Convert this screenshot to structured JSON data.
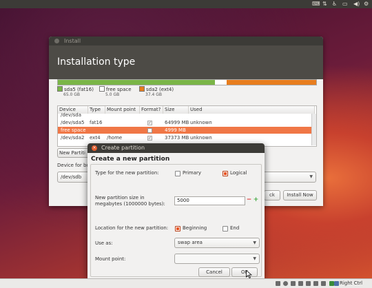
{
  "installer": {
    "window_title": "Install",
    "header": "Installation type",
    "legend": [
      {
        "label": "sda5 (fat16)",
        "size": "65.0 GB",
        "color": "#7ab547"
      },
      {
        "label": "free space",
        "size": "5.0 GB",
        "color": "#ffffff"
      },
      {
        "label": "sda2 (ext4)",
        "size": "37.4 GB",
        "color": "#e87d1e"
      }
    ],
    "table": {
      "headers": [
        "Device",
        "Type",
        "Mount point",
        "Format?",
        "Size",
        "Used"
      ],
      "rows": [
        {
          "device": "/dev/sda",
          "type": "",
          "mount": "",
          "format": false,
          "size": "",
          "used": ""
        },
        {
          "device": "/dev/sda5",
          "type": "fat16",
          "mount": "",
          "format": true,
          "size": "64999 MB",
          "used": "unknown"
        },
        {
          "device": "free space",
          "type": "",
          "mount": "",
          "format": false,
          "size": "4999 MB",
          "used": "",
          "selected": true
        },
        {
          "device": "/dev/sda2",
          "type": "ext4",
          "mount": "/home",
          "format": true,
          "size": "37373 MB",
          "used": "unknown"
        }
      ]
    },
    "new_partition_label": "New Partiti",
    "device_label": "Device for bo",
    "device_value": "/dev/sdb",
    "back_label": "ck",
    "install_now_label": "Install Now"
  },
  "dialog": {
    "title": "Create partition",
    "heading": "Create a new partition",
    "type_label": "Type for the new partition:",
    "type_options": [
      "Primary",
      "Logical"
    ],
    "type_selected": "Logical",
    "size_label_1": "New partition size in",
    "size_label_2": "megabytes (1000000 bytes):",
    "size_value": "5000",
    "location_label": "Location for the new partition:",
    "location_options": [
      "Beginning",
      "End"
    ],
    "location_selected": "Beginning",
    "use_as_label": "Use as:",
    "use_as_value": "swap area",
    "mount_label": "Mount point:",
    "mount_value": "",
    "cancel_label": "Cancel",
    "ok_label": "OK"
  },
  "bottom_panel": {
    "host_key": "Right Ctrl"
  }
}
